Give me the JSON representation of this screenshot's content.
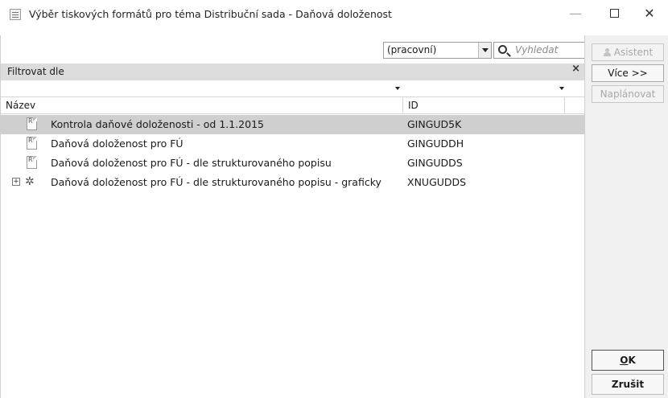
{
  "window": {
    "title": "Výběr tiskových formátů pro téma Distribuční sada - Daňová doloženost",
    "minimize": "—",
    "close": "✕"
  },
  "toolbar": {
    "combo_value": "(pracovní)",
    "search_placeholder": "Vyhledat"
  },
  "filter": {
    "label": "Filtrovat dle",
    "close": "×"
  },
  "table": {
    "headers": {
      "name": "Název",
      "id": "ID"
    },
    "rows": [
      {
        "name": "Kontrola daňové doloženosti - od 1.1.2015",
        "id": "GINGUD5K",
        "icon": "report-icon",
        "selected": true
      },
      {
        "name": "Daňová doloženost pro FÚ",
        "id": "GINGUDDH",
        "icon": "report-icon"
      },
      {
        "name": "Daňová doloženost pro FÚ - dle strukturovaného popisu",
        "id": "GINGUDDS",
        "icon": "report-icon"
      },
      {
        "name": "Daňová doloženost pro FÚ - dle strukturovaného popisu - graficky",
        "id": "XNUGUDDS",
        "icon": "gear-icon",
        "expandable": true
      }
    ]
  },
  "side": {
    "asistent": "Asistent",
    "vice": "Více >>",
    "naplanovat": "Naplánovat",
    "ok_underlined": "O",
    "ok_rest": "K",
    "cancel": "Zrušit"
  }
}
